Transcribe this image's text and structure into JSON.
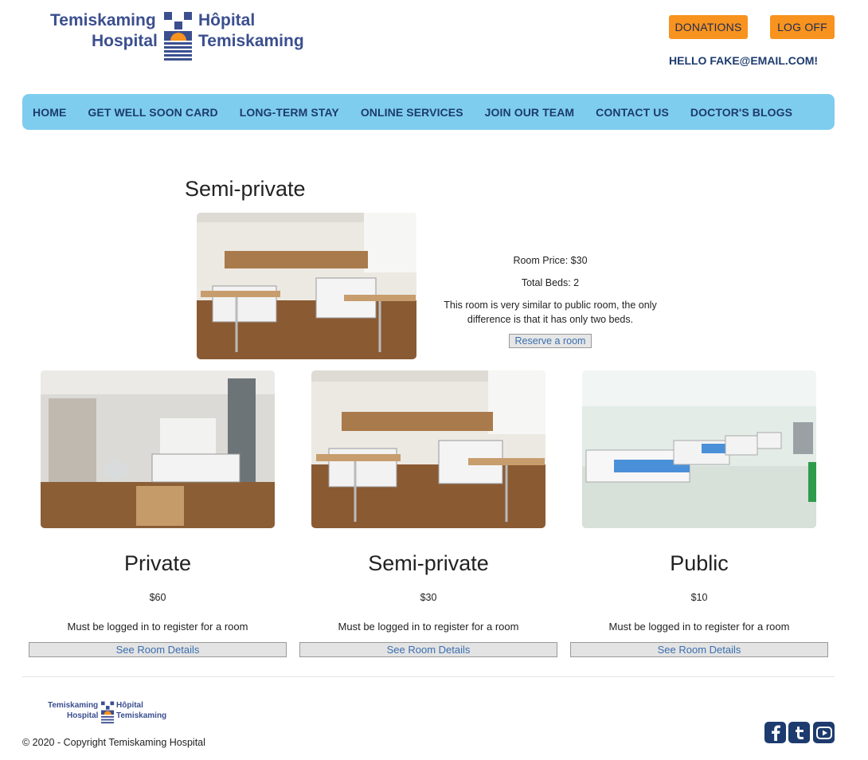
{
  "header": {
    "logo_en_line1": "Temiskaming",
    "logo_en_line2": "Hospital",
    "logo_fr_line1": "Hôpital",
    "logo_fr_line2": "Temiskaming",
    "donations_label": "DONATIONS",
    "logoff_label": "LOG OFF",
    "greeting": "HELLO FAKE@EMAIL.COM!"
  },
  "nav": {
    "items": [
      {
        "label": "HOME"
      },
      {
        "label": "GET WELL SOON CARD"
      },
      {
        "label": "LONG-TERM STAY"
      },
      {
        "label": "ONLINE SERVICES"
      },
      {
        "label": "JOIN OUR TEAM"
      },
      {
        "label": "CONTACT US"
      },
      {
        "label": "DOCTOR'S BLOGS"
      }
    ]
  },
  "featured": {
    "title": "Semi-private",
    "price": "Room Price: $30",
    "beds": "Total Beds: 2",
    "description": "This room is very similar to public room, the only difference is that it has only two beds.",
    "reserve_label": "Reserve a room"
  },
  "rooms": [
    {
      "title": "Private",
      "price": "$60",
      "note": "Must be logged in to register for a room",
      "button": "See Room Details"
    },
    {
      "title": "Semi-private",
      "price": "$30",
      "note": "Must be logged in to register for a room",
      "button": "See Room Details"
    },
    {
      "title": "Public",
      "price": "$10",
      "note": "Must be logged in to register for a room",
      "button": "See Room Details"
    }
  ],
  "footer": {
    "copyright": "© 2020 - Copyright Temiskaming Hospital",
    "social_icons": [
      "facebook-icon",
      "twitter-icon",
      "youtube-icon"
    ]
  },
  "colors": {
    "brand_blue": "#3b4f8f",
    "nav_bg": "#7ecdef",
    "accent_orange": "#f7931e",
    "link_blue": "#3a6fb0"
  }
}
